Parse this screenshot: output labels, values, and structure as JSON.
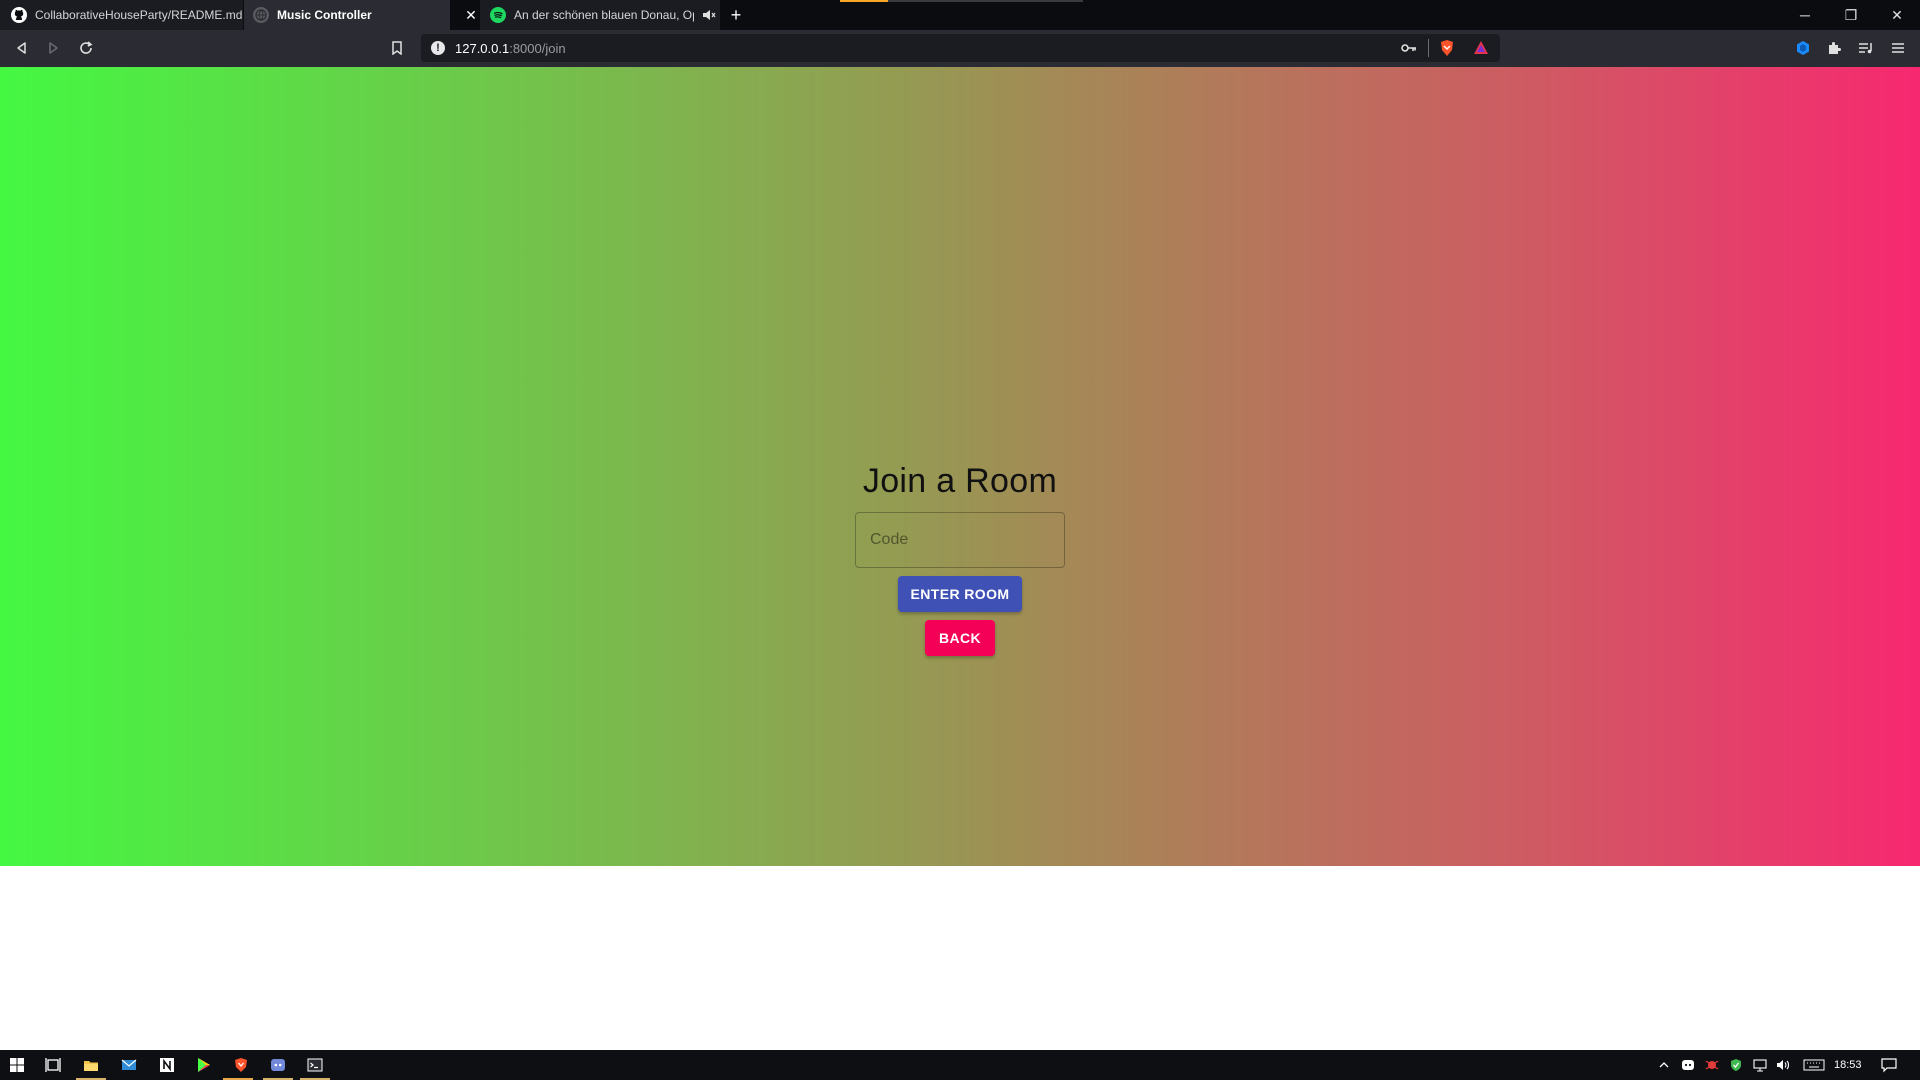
{
  "browser": {
    "tabs": [
      {
        "title": "CollaborativeHouseParty/README.md",
        "favicon": "github-icon",
        "active": false
      },
      {
        "title": "Music Controller",
        "favicon": "globe-icon",
        "active": true
      },
      {
        "title": "An der schönen blauen Donau, Op",
        "favicon": "spotify-icon",
        "active": false,
        "audio": "muted"
      }
    ],
    "close_tab_glyph": "✕",
    "new_tab_glyph": "+",
    "url": {
      "host": "127.0.0.1",
      "rest": ":8000/join"
    },
    "window_controls": {
      "minimize": "─",
      "restore": "❐",
      "close": "✕"
    }
  },
  "page": {
    "title": "Join a Room",
    "code_input": {
      "placeholder": "Code",
      "value": ""
    },
    "enter_button": "Enter Room",
    "back_button": "Back",
    "gradient": [
      "#44f842",
      "#f72870"
    ],
    "enter_color": "#3f51b5",
    "back_color": "#f50057"
  },
  "taskbar": {
    "apps": [
      "windows-start-icon",
      "task-view-icon",
      "file-explorer-icon",
      "mail-icon",
      "notion-icon",
      "play-store-icon",
      "brave-icon",
      "discord-icon",
      "terminal-icon"
    ],
    "time": "18:53"
  }
}
